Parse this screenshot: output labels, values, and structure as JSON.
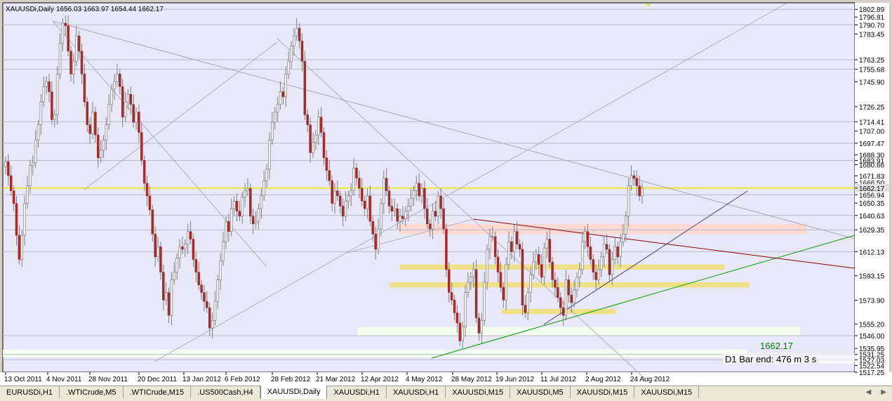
{
  "header": {
    "symbol": "XAUUSDi,Daily",
    "ohlc": "1656.03 1663.97 1654.44 1662.17"
  },
  "overlay": {
    "last_price": "1662.17",
    "bar_end_text": "D1 Bar end: 476 m 3 s"
  },
  "colors": {
    "plot_bg": "#e8e8f8",
    "bull_body": "#f0f0f0",
    "bear_body": "#a52a2a",
    "wick": "#808080",
    "current_price_line": "#e8e800",
    "green_trendline": "#00a000",
    "maroon_trendline": "#8b0000",
    "support_band_yellow": "#f0e080",
    "resistance_band_pink": "#ffd8d0",
    "support_band_white": "#f4fff0"
  },
  "tabs": [
    {
      "label": "EURUSDi,H1",
      "active": false
    },
    {
      "label": ".WTICrude,M5",
      "active": false
    },
    {
      "label": ".WTICrude,M15",
      "active": false
    },
    {
      "label": ".US500Cash,H4",
      "active": false
    },
    {
      "label": "XAUUSDi,Daily",
      "active": true
    },
    {
      "label": "XAUUSDi,H1",
      "active": false
    },
    {
      "label": "XAUUSDi,H1",
      "active": false
    },
    {
      "label": "XAUUSDi,M15",
      "active": false
    },
    {
      "label": "XAUUSDi,M5",
      "active": false
    },
    {
      "label": "XAUUSDi,M15",
      "active": false
    },
    {
      "label": "XAUUSDi,M15",
      "active": false
    }
  ],
  "chart_data": {
    "type": "candlestick",
    "symbol": "XAUUSDi",
    "timeframe": "Daily",
    "ylim": [
      1517.25,
      1808
    ],
    "price_ticks": [
      "1802.89",
      "1796.81",
      "1790.70",
      "1783.45",
      "1763.25",
      "1755.68",
      "1745.90",
      "1726.25",
      "1714.41",
      "1707.00",
      "1697.47",
      "1688.30",
      "1683.91",
      "1680.66",
      "1671.83",
      "1666.50",
      "1662.17",
      "1656.94",
      "1650.35",
      "1640.63",
      "1629.35",
      "1612.13",
      "1593.15",
      "1573.90",
      "1555.20",
      "1546.00",
      "1535.95",
      "1531.25",
      "1527.03",
      "1522.54",
      "1517.25"
    ],
    "date_labels": [
      "13 Oct 2011",
      "4 Nov 2011",
      "28 Nov 2011",
      "20 Dec 2011",
      "13 Jan 2012",
      "6 Feb 2012",
      "28 Feb 2012",
      "21 Mar 2012",
      "12 Apr 2012",
      "4 May 2012",
      "28 May 2012",
      "19 Jun 2012",
      "11 Jul 2012",
      "2 Aug 2012",
      "24 Aug 2012"
    ],
    "last_close": 1662.17,
    "series": [
      {
        "name": "XAUUSDi",
        "closes": [
          1683,
          1672,
          1660,
          1650,
          1625,
          1606,
          1625,
          1650,
          1664,
          1680,
          1682,
          1700,
          1712,
          1730,
          1742,
          1746,
          1738,
          1716,
          1720,
          1752,
          1776,
          1792,
          1790,
          1770,
          1752,
          1762,
          1782,
          1770,
          1752,
          1730,
          1712,
          1705,
          1722,
          1704,
          1686,
          1692,
          1700,
          1712,
          1728,
          1740,
          1746,
          1752,
          1742,
          1718,
          1730,
          1736,
          1728,
          1714,
          1722,
          1706,
          1684,
          1666,
          1656,
          1645,
          1626,
          1608,
          1616,
          1596,
          1574,
          1580,
          1562,
          1590,
          1596,
          1607,
          1616,
          1614,
          1618,
          1628,
          1622,
          1606,
          1596,
          1586,
          1580,
          1573,
          1568,
          1552,
          1558,
          1573,
          1590,
          1605,
          1620,
          1636,
          1628,
          1646,
          1652,
          1644,
          1640,
          1655,
          1660,
          1662,
          1640,
          1634,
          1636,
          1646,
          1656,
          1668,
          1677,
          1700,
          1714,
          1722,
          1728,
          1738,
          1734,
          1752,
          1762,
          1774,
          1782,
          1788,
          1778,
          1762,
          1720,
          1712,
          1690,
          1698,
          1704,
          1718,
          1706,
          1686,
          1676,
          1668,
          1650,
          1660,
          1656,
          1648,
          1640,
          1652,
          1656,
          1660,
          1678,
          1670,
          1662,
          1652,
          1646,
          1656,
          1636,
          1626,
          1614,
          1630,
          1650,
          1670,
          1660,
          1648,
          1644,
          1646,
          1636,
          1640,
          1638,
          1644,
          1648,
          1654,
          1660,
          1666,
          1656,
          1662,
          1646,
          1634,
          1630,
          1644,
          1640,
          1656,
          1646,
          1630,
          1598,
          1580,
          1574,
          1564,
          1556,
          1542,
          1553,
          1580,
          1588,
          1592,
          1598,
          1560,
          1548,
          1558,
          1588,
          1614,
          1624,
          1624,
          1608,
          1596,
          1584,
          1574,
          1602,
          1620,
          1612,
          1628,
          1618,
          1614,
          1570,
          1564,
          1580,
          1594,
          1604,
          1610,
          1602,
          1592,
          1615,
          1622,
          1604,
          1590,
          1584,
          1576,
          1568,
          1562,
          1590,
          1578,
          1572,
          1582,
          1592,
          1598,
          1620,
          1628,
          1616,
          1606,
          1596,
          1590,
          1598,
          1608,
          1618,
          1614,
          1594,
          1606,
          1616,
          1608,
          1620,
          1626,
          1640,
          1664,
          1672,
          1670,
          1664,
          1656,
          1662.17
        ]
      }
    ],
    "horizontal_levels": [
      1802.89,
      1790.7,
      1763.25,
      1755.68,
      1714.41,
      1697.47,
      1683.91,
      1662.17,
      1656.94,
      1640.63,
      1629.35,
      1612.13,
      1546.0,
      1531.25,
      1527.03
    ],
    "bands": [
      {
        "color": "pink",
        "from": 1626,
        "to": 1634
      },
      {
        "color": "yellow",
        "from": 1598,
        "to": 1602
      },
      {
        "color": "yellow",
        "from": 1584,
        "to": 1588
      },
      {
        "color": "yellow",
        "from": 1563,
        "to": 1567
      },
      {
        "color": "white",
        "from": 1546,
        "to": 1553
      },
      {
        "color": "white",
        "from": 1529,
        "to": 1535
      }
    ],
    "grid": false,
    "legend": "none"
  }
}
